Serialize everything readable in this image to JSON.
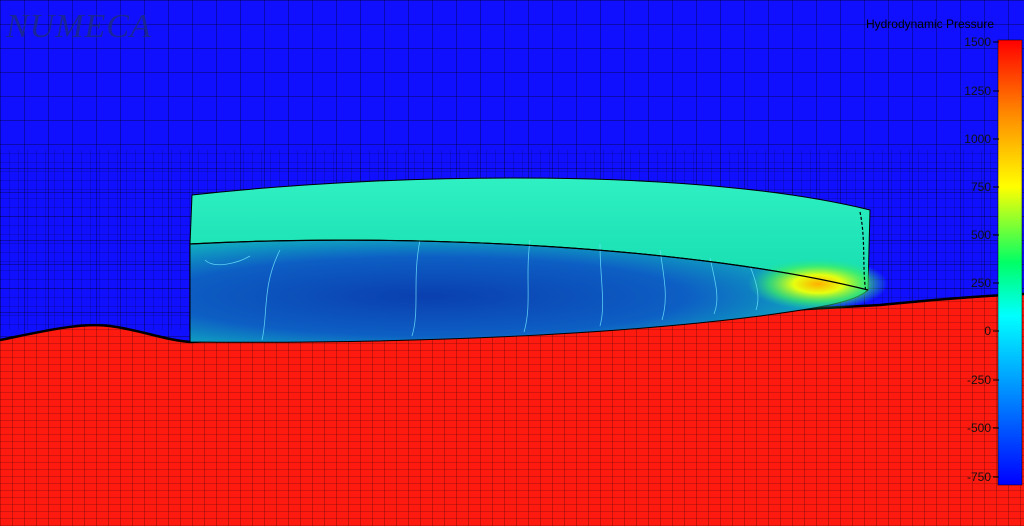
{
  "branding": {
    "logo_text": "NUMECA"
  },
  "legend": {
    "title": "Hydrodynamic Pressure",
    "ticks": [
      "1500",
      "1250",
      "1000",
      "750",
      "500",
      "250",
      "0",
      "-250",
      "-500",
      "-750"
    ],
    "max": 1500,
    "min": -750,
    "colors": [
      "#ff0000",
      "#ff8c00",
      "#ffff00",
      "#00ff66",
      "#00ffff",
      "#0088ff",
      "#0000ff"
    ]
  },
  "scene": {
    "air_color": "#1010ff",
    "water_color": "#ff1a10",
    "hull_top_color": "#22e6b4",
    "hull_bottom_color": "#0a3aa8"
  }
}
